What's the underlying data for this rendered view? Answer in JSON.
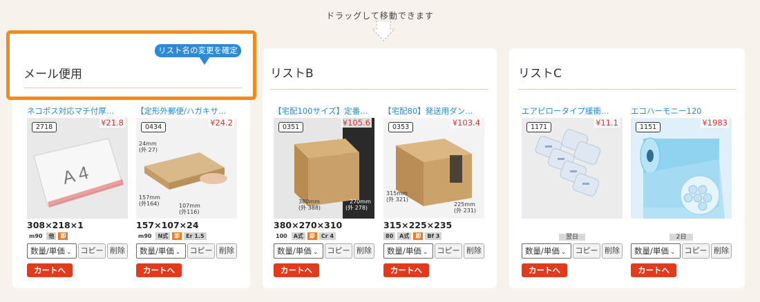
{
  "drag_hint": "ドラッグして移動できます",
  "edit_list": {
    "confirm_label": "リスト名の変更を確定",
    "title": "メール便用"
  },
  "lists": [
    {
      "title": "メール便用",
      "products": [
        {
          "name": "ネコポス対応マチ付厚…",
          "code": "2718",
          "price": "¥21.8",
          "size": "308×218×1",
          "badges": [
            "m90",
            "他",
            "即"
          ],
          "days": "",
          "qty_label": "数量/単価",
          "copy_label": "コピー",
          "delete_label": "削除",
          "cart_label": "カートへ"
        },
        {
          "name": "【定形外郵便/ハガキサ…",
          "code": "0434",
          "price": "¥24.2",
          "size": "157×107×24",
          "badges": [
            "m90",
            "N式",
            "即",
            "Er 1.5"
          ],
          "days": "",
          "qty_label": "数量/単価",
          "copy_label": "コピー",
          "delete_label": "削除",
          "cart_label": "カートへ"
        }
      ]
    },
    {
      "title": "リストB",
      "products": [
        {
          "name": "【宅配100サイズ】定番…",
          "code": "0351",
          "price": "¥105.6",
          "size": "380×270×310",
          "badges": [
            "100",
            "A式",
            "即",
            "Cr 4"
          ],
          "days": "",
          "qty_label": "数量/単価",
          "copy_label": "コピー",
          "delete_label": "削除",
          "cart_label": "カートへ"
        },
        {
          "name": "【宅配80】発送用ダン…",
          "code": "0353",
          "price": "¥103.4",
          "size": "315×225×235",
          "badges": [
            "80",
            "A式",
            "即",
            "Bf 3"
          ],
          "days": "",
          "qty_label": "数量/単価",
          "copy_label": "コピー",
          "delete_label": "削除",
          "cart_label": "カートへ"
        }
      ]
    },
    {
      "title": "リストC",
      "products": [
        {
          "name": "エアピロータイプ緩衝…",
          "code": "1171",
          "price": "¥11.1",
          "size": "",
          "badges": [],
          "days": "翌日",
          "qty_label": "数量/単価",
          "copy_label": "コピー",
          "delete_label": "削除",
          "cart_label": "カートへ"
        },
        {
          "name": "エコハーモニー120",
          "code": "1151",
          "price": "¥1983",
          "size": "",
          "badges": [],
          "days": "2日",
          "qty_label": "数量/単価",
          "copy_label": "コピー",
          "delete_label": "削除",
          "cart_label": "カートへ"
        }
      ]
    }
  ],
  "image_labels": {
    "p0": {
      "main": "A 4"
    },
    "p1": {
      "d1": "24mm",
      "d1b": "(外 27)",
      "d2": "157mm",
      "d2b": "(外164)",
      "d3": "107mm",
      "d3b": "(外116)"
    },
    "p2": {
      "d1": "380mm",
      "d1b": "(外 388)",
      "d2": "270mm",
      "d2b": "(外 278)"
    },
    "p3": {
      "d1": "315mm",
      "d1b": "(外 321)",
      "d2": "225mm",
      "d2b": "(外 231)"
    }
  },
  "colors": {
    "accent_orange": "#f28a1c",
    "link_blue": "#2a8ad4",
    "price_red": "#e0302a",
    "cart_red": "#e23a1c",
    "confirm_blue": "#2c8ad8"
  }
}
